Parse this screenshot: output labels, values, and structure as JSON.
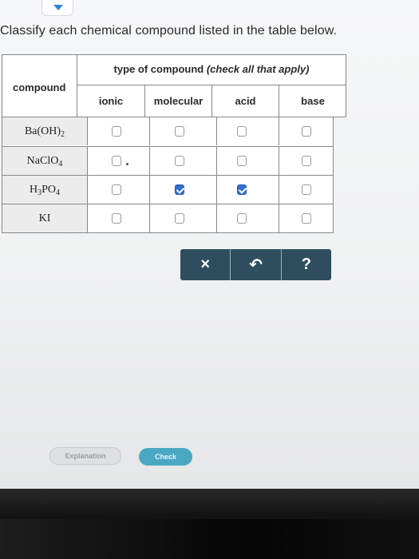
{
  "question": {
    "instruction": "Classify each chemical compound listed in the table below."
  },
  "table": {
    "compound_header": "compound",
    "type_header": "type of compound",
    "type_header_note": "(check all that apply)",
    "columns": [
      "ionic",
      "molecular",
      "acid",
      "base"
    ],
    "rows": [
      {
        "base": "Ba",
        "formula_parts": [
          "(OH)",
          "2"
        ],
        "checks": [
          false,
          false,
          false,
          false
        ]
      },
      {
        "base": "NaClO",
        "formula_parts": [
          "",
          "4"
        ],
        "checks": [
          false,
          false,
          false,
          false
        ]
      },
      {
        "base": "H",
        "formula_parts": [
          "3",
          "PO",
          "4"
        ],
        "checks": [
          false,
          true,
          true,
          false
        ]
      },
      {
        "base": "KI",
        "formula_parts": [],
        "checks": [
          false,
          false,
          false,
          false
        ]
      }
    ]
  },
  "actions": {
    "clear": "×",
    "undo": "↶",
    "help": "?"
  },
  "footer": {
    "explanation": "Explanation",
    "check": "Check"
  },
  "colors": {
    "action_bar": "#2e4e5f",
    "checked": "#2d6fd0",
    "check_button": "#4aa8c2"
  }
}
